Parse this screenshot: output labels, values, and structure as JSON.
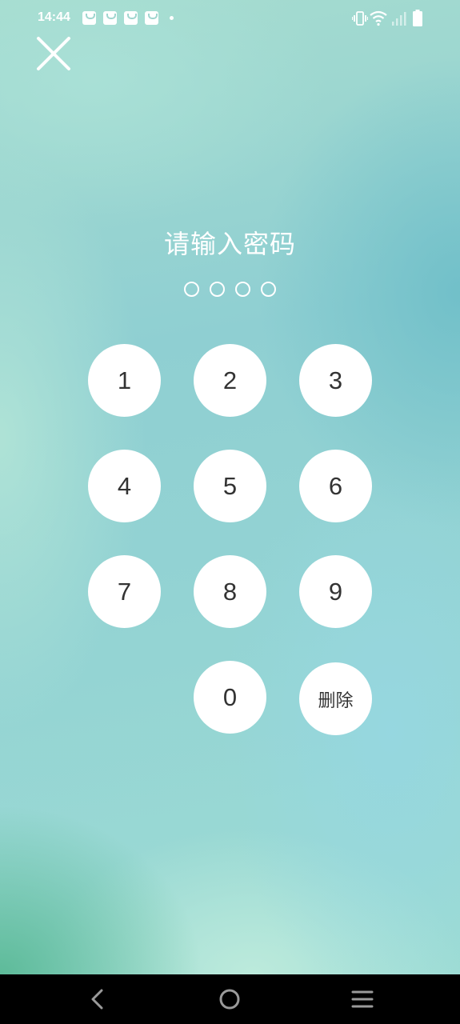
{
  "status_bar": {
    "time": "14:44",
    "notification_icons": [
      "shopping-bag-icon",
      "shopping-bag-icon",
      "shopping-bag-icon",
      "shopping-bag-icon"
    ],
    "system_icons": [
      "vibrate-icon",
      "wifi-icon",
      "signal-icon",
      "battery-icon"
    ]
  },
  "header": {
    "close_icon": "close-icon"
  },
  "prompt": {
    "title": "请输入密码",
    "pin_length": 4,
    "entered": 0
  },
  "keypad": {
    "keys": [
      "1",
      "2",
      "3",
      "4",
      "5",
      "6",
      "7",
      "8",
      "9",
      "0"
    ],
    "delete_label": "删除"
  },
  "nav_bar": {
    "icons": [
      "back-icon",
      "home-icon",
      "menu-icon"
    ]
  },
  "colors": {
    "key_background": "#ffffff",
    "key_text": "#333333",
    "title_text": "#ffffff",
    "nav_background": "#000000"
  }
}
